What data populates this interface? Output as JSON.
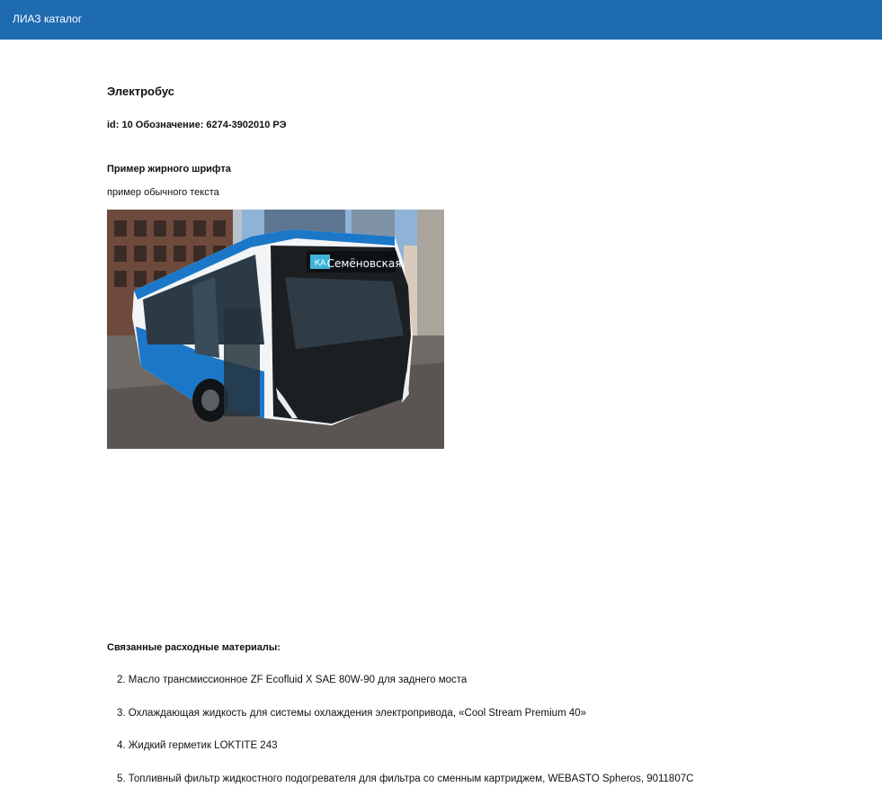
{
  "header": {
    "brand": "ЛИАЗ каталог",
    "color": "#1f6bb0"
  },
  "product": {
    "title": "Электробус",
    "id_line": "id: 10 Обозначение: 6274-3902010 РЭ",
    "bold_sample": "Пример жирного шрифта",
    "normal_sample": "пример обычного текста",
    "image": {
      "icon": "electric-bus-photo",
      "route_badge": "КА",
      "destination": "Семёновская"
    }
  },
  "related": {
    "title": "Связанные расходные материалы:",
    "items": [
      "2. Масло трансмиссионное ZF Ecofluid X SAE 80W-90 для заднего моста",
      "3. Охлаждающая жидкость для системы охлаждения электропривода, «Cool Stream Premium 40»",
      "4. Жидкий герметик LOKTITE 243",
      "5. Топливный фильтр жидкостного подогревателя для фильтра со сменным картриджем, WEBASTO Spheros, 9011807C"
    ]
  }
}
